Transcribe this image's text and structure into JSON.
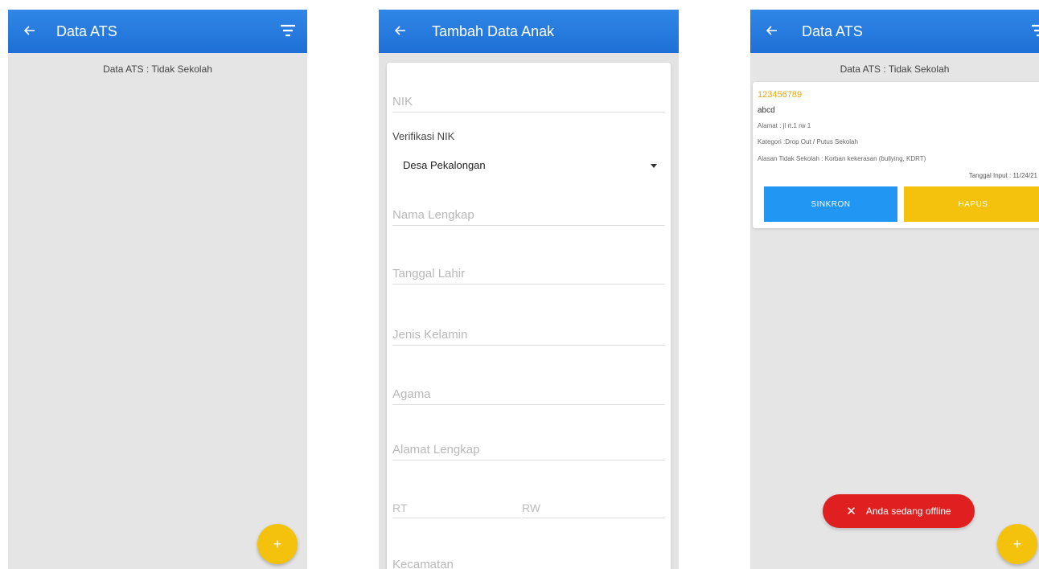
{
  "screen1": {
    "title": "Data ATS",
    "subtitle": "Data ATS : Tidak Sekolah",
    "fab": "+"
  },
  "screen2": {
    "title": "Tambah Data Anak",
    "fields": {
      "nik": "NIK",
      "verif_label": "Verifikasi NIK",
      "desa_value": "Desa Pekalongan",
      "nama": "Nama Lengkap",
      "tgl_lahir": "Tanggal Lahir",
      "jk": "Jenis Kelamin",
      "agama": "Agama",
      "alamat": "Alamat Lengkap",
      "rt": "RT",
      "rw": "RW",
      "kecamatan": "Kecamatan"
    }
  },
  "screen3": {
    "title": "Data ATS",
    "subtitle": "Data ATS : Tidak Sekolah",
    "card": {
      "nik": "123456789",
      "name": "abcd",
      "alamat": "Alamat : jl rt.1 rw 1",
      "kategori": "Kategori :Drop Out / Putus Sekolah",
      "alasan": "Alasan Tidak Sekolah : Korban kekerasan (bullying, KDRT)",
      "tanggal": "Tanggal Input : 11/24/21",
      "sync_label": "SINKRON",
      "delete_label": "HAPUS"
    },
    "toast": "Anda sedang offline",
    "toast_icon": "✕",
    "fab": "+"
  },
  "colors": {
    "appbar": "#1f6fd6",
    "fab": "#f4c20d",
    "sync": "#2196f3",
    "delete": "#f4c20d",
    "toast": "#e02020",
    "nik_accent": "#f0a500"
  }
}
